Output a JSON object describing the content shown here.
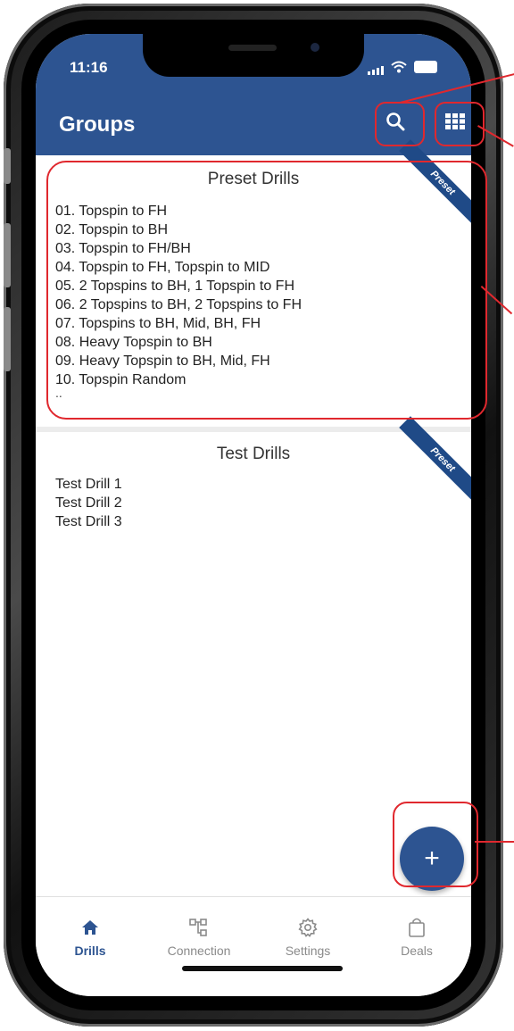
{
  "status_bar": {
    "time": "11:16"
  },
  "app_bar": {
    "title": "Groups"
  },
  "icons": {
    "search": "search-icon",
    "grid": "grid-view-icon",
    "add": "plus-icon",
    "home": "home-icon",
    "connection": "network-icon",
    "settings": "gear-icon",
    "deals": "shopping-bag-icon"
  },
  "groups": [
    {
      "title": "Preset Drills",
      "badge": "Preset",
      "drills": [
        "01. Topspin to FH",
        "02. Topspin to BH",
        "03. Topspin to FH/BH",
        "04. Topspin to FH, Topspin to MID",
        "05. 2 Topspins to BH, 1 Topspin to FH",
        "06. 2 Topspins to BH, 2 Topspins to FH",
        "07. Topspins to BH, Mid, BH, FH",
        "08. Heavy Topspin to BH",
        "09. Heavy Topspin to BH, Mid, FH",
        "10. Topspin Random"
      ],
      "more": ".."
    },
    {
      "title": "Test Drills",
      "badge": "Preset",
      "drills": [
        "Test Drill 1",
        "Test Drill 2",
        "Test Drill 3"
      ]
    }
  ],
  "fab": {
    "label": "+"
  },
  "bottom_nav": [
    {
      "label": "Drills",
      "active": true
    },
    {
      "label": "Connection",
      "active": false
    },
    {
      "label": "Settings",
      "active": false
    },
    {
      "label": "Deals",
      "active": false
    }
  ],
  "colors": {
    "primary": "#2d5491",
    "highlight": "#e0282e",
    "inactive": "#8a8a8a"
  }
}
